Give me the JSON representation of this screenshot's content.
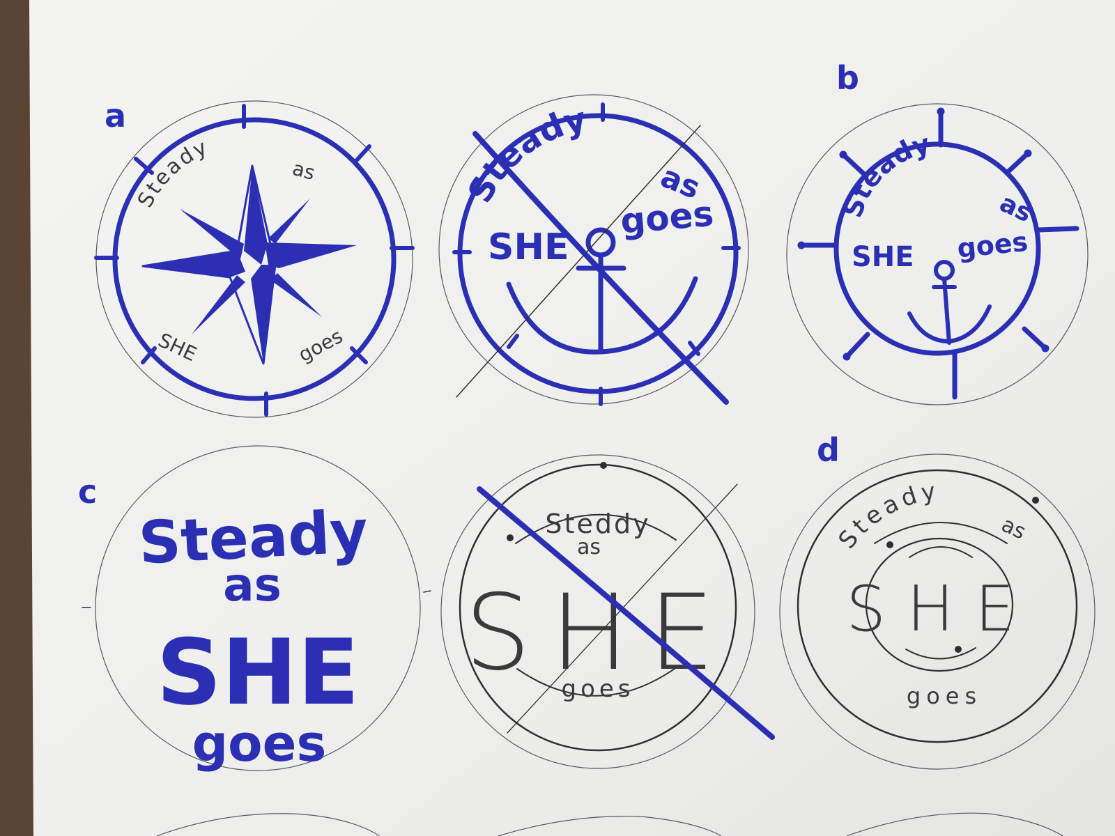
{
  "labels": {
    "a": "a",
    "b": "b",
    "c": "c",
    "d": "d"
  },
  "sketch_a": {
    "top": "Steady",
    "top_right": "as",
    "bottom_left": "SHE",
    "bottom_right": "goes"
  },
  "sketch_crossed_1": {
    "line1": "Steady",
    "line1b": "as",
    "line2a": "SHE",
    "line2b": "goes"
  },
  "sketch_b": {
    "line1": "Steady",
    "line1b": "as",
    "line2a": "SHE",
    "line2b": "goes"
  },
  "sketch_c": {
    "line1": "Steady",
    "line2": "as",
    "line3": "SHE",
    "line4": "goes"
  },
  "sketch_crossed_2": {
    "top": "Steddy",
    "sub": "as",
    "big": "SHE",
    "bottom": "goes"
  },
  "sketch_d": {
    "top": "Steady",
    "top_right": "as",
    "big": "SHE",
    "bottom": "goes"
  },
  "colors": {
    "ink_blue": "#2a2fb4",
    "pencil": "#2e2e30",
    "paper": "#f1f1ef",
    "table": "#5a4434"
  }
}
